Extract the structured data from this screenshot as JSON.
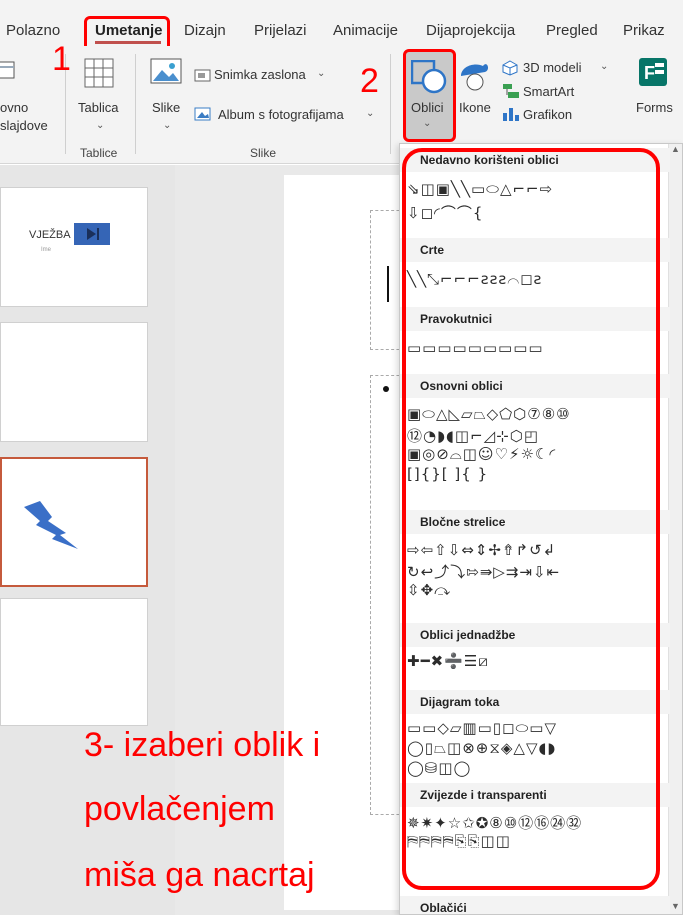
{
  "ribbon": {
    "tabs": [
      "Polazno",
      "Umetanje",
      "Dizajn",
      "Prijelazi",
      "Animacije",
      "Dijaprojekcija",
      "Pregled",
      "Prikaz"
    ],
    "active_tab": "Umetanje",
    "new_slide_label_1": "ovno",
    "new_slide_label_2": "slajdove",
    "table_label": "Tablica",
    "images_label": "Slike",
    "screenshot_label": "Snimka zaslona",
    "album_label": "Album s fotografijama",
    "shapes_label": "Oblici",
    "icons_label": "Ikone",
    "models_label": "3D modeli",
    "smartart_label": "SmartArt",
    "chart_label": "Grafikon",
    "forms_label": "Forms",
    "group_tables": "Tablice",
    "group_images": "Slike"
  },
  "thumbs": {
    "slide1_title": "VJEŽBA",
    "slide1_sub": "Ime"
  },
  "shapes_menu": {
    "sections": [
      {
        "title": "Nedavno korišteni oblici",
        "rows": [
          "⇘◫▣╲╲▭⬭△⌐⌐⇨",
          "⇩◻◜⌒⌒{"
        ]
      },
      {
        "title": "Crte",
        "rows": [
          "╲╲⤡⌐⌐⌐ƨƨƨ⌒◻ƨ"
        ]
      },
      {
        "title": "Pravokutnici",
        "rows": [
          "▭▭▭▭▭▭▭▭▭"
        ]
      },
      {
        "title": "Osnovni oblici",
        "rows": [
          "▣⬭△◺▱⏢◇⬠⬡⑦⑧⑩",
          "⑫◔◗◖◫⌐◿⊹⬡◰",
          "▣◎⊘⌓◫☺♡⚡☼☾◜",
          "[]{}[ ]{ }"
        ]
      },
      {
        "title": "Bločne strelice",
        "rows": [
          "⇨⇦⇧⇩⇔⇕✢⇮↱↺↲",
          "↻↩⤴⤵⇰⇛▷⇉⇥⇩⇤",
          "⇳✥⤼"
        ]
      },
      {
        "title": "Oblici jednadžbe",
        "rows": [
          "✚━✖➗☰⧄"
        ]
      },
      {
        "title": "Dijagram toka",
        "rows": [
          "▭▭◇▱▥▭▯◻⬭▭▽",
          "◯▯⏢◫⊗⊕⧖◈△▽◖◗",
          "◯⛁◫◯"
        ]
      },
      {
        "title": "Zvijezde i transparenti",
        "rows": [
          "✵✷✦☆✩✪⑧⑩⑫⑯㉔㉜",
          "⛿⛿⛿⛿⎘⎘◫◫"
        ]
      },
      {
        "title": "Oblačići",
        "rows": []
      }
    ]
  },
  "annotations": {
    "step1": "1",
    "step2": "2",
    "step3_line1": "3- izaberi oblik i",
    "step3_line2": "povlačenjem",
    "step3_line3": "miša ga nacrtaj",
    "color": "#ff0000"
  }
}
